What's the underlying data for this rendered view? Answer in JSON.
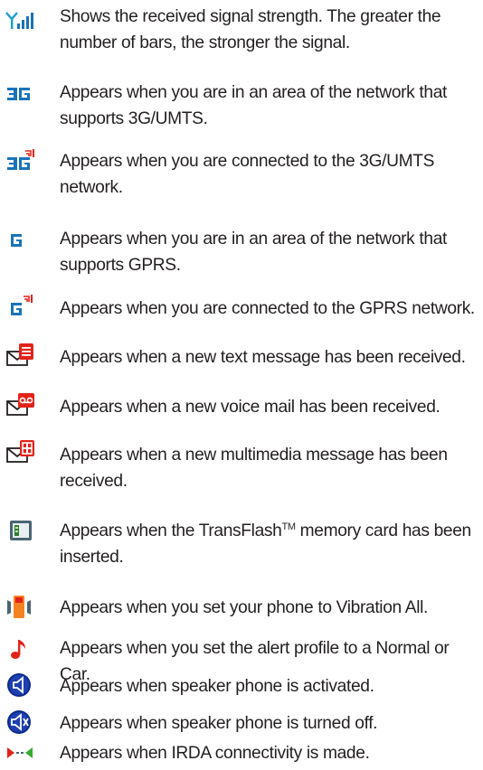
{
  "items": [
    {
      "icon": "signal-strength-icon",
      "text": "Shows the received signal strength. The greater the number of bars, the stronger the signal."
    },
    {
      "icon": "3g-network-available-icon",
      "text": "Appears when you are in an area of the network that supports 3G/UMTS."
    },
    {
      "icon": "3g-connected-icon",
      "text": "Appears when you are connected to the 3G/UMTS network."
    },
    {
      "icon": "gprs-network-available-icon",
      "text": "Appears when you are in an area of the network that supports GPRS."
    },
    {
      "icon": "gprs-connected-icon",
      "text": "Appears when you are connected to the GPRS network."
    },
    {
      "icon": "new-text-message-icon",
      "text": "Appears when a new text message has been received."
    },
    {
      "icon": "new-voice-mail-icon",
      "text": "Appears when a new voice mail has been received."
    },
    {
      "icon": "new-multimedia-message-icon",
      "text": "Appears when a new multimedia message has been received."
    },
    {
      "icon": "memory-card-icon",
      "text_before": "Appears when the TransFlash",
      "text_sup": "TM",
      "text_after": " memory card has been inserted."
    },
    {
      "icon": "vibration-all-icon",
      "text": "Appears when you set your phone to Vibration All."
    },
    {
      "icon": "alert-profile-note-icon",
      "text": "Appears when you set the alert profile to a Normal or Car."
    },
    {
      "icon": "speaker-on-icon",
      "text": "Appears when speaker phone is activated."
    },
    {
      "icon": "speaker-off-icon",
      "text": "Appears when speaker phone is turned off."
    },
    {
      "icon": "irda-icon",
      "text": "Appears when IRDA connectivity is made."
    }
  ],
  "colors": {
    "text": "#231f20",
    "icon_blue": "#1a73b8",
    "icon_red": "#e2231a",
    "icon_orange": "#f58220"
  }
}
